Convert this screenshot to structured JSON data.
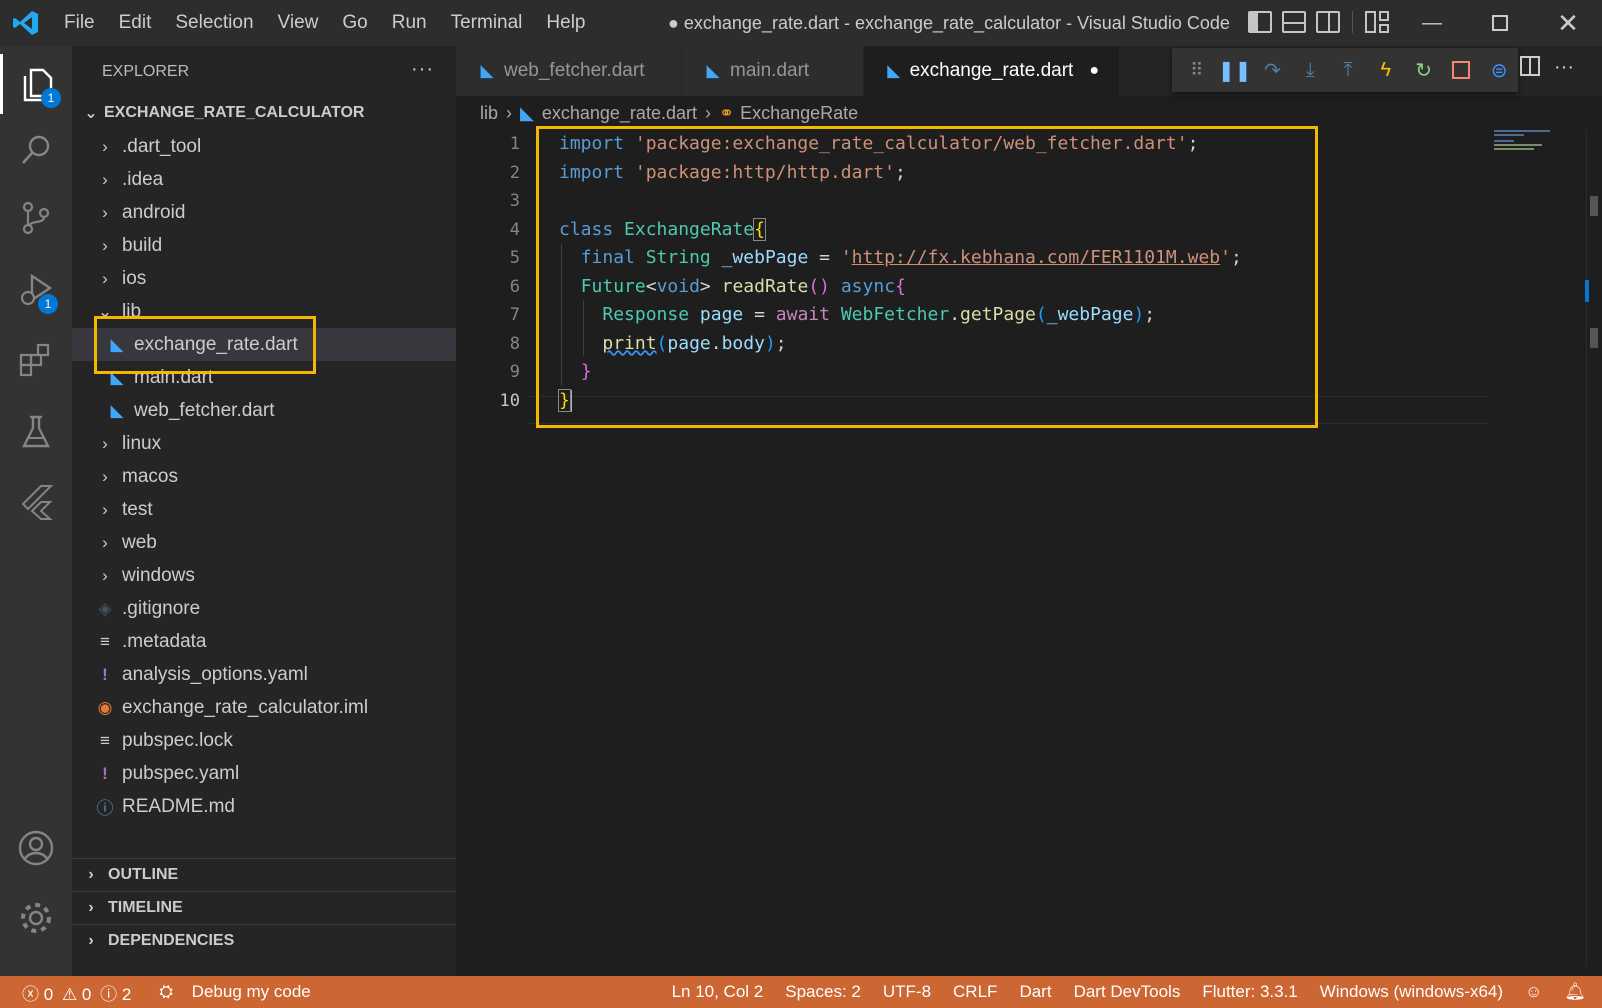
{
  "app": {
    "title": "● exchange_rate.dart - exchange_rate_calculator - Visual Studio Code"
  },
  "menu": [
    "File",
    "Edit",
    "Selection",
    "View",
    "Go",
    "Run",
    "Terminal",
    "Help"
  ],
  "activity": {
    "explorer_badge": "1",
    "debug_badge": "1"
  },
  "explorer": {
    "header": "EXPLORER",
    "more": "···",
    "project": "EXCHANGE_RATE_CALCULATOR",
    "items": [
      {
        "label": ".dart_tool",
        "type": "folder"
      },
      {
        "label": ".idea",
        "type": "folder"
      },
      {
        "label": "android",
        "type": "folder"
      },
      {
        "label": "build",
        "type": "folder"
      },
      {
        "label": "ios",
        "type": "folder"
      },
      {
        "label": "lib",
        "type": "folder-open"
      },
      {
        "label": "exchange_rate.dart",
        "type": "dart"
      },
      {
        "label": "main.dart",
        "type": "dart"
      },
      {
        "label": "web_fetcher.dart",
        "type": "dart"
      },
      {
        "label": "linux",
        "type": "folder"
      },
      {
        "label": "macos",
        "type": "folder"
      },
      {
        "label": "test",
        "type": "folder"
      },
      {
        "label": "web",
        "type": "folder"
      },
      {
        "label": "windows",
        "type": "folder"
      },
      {
        "label": ".gitignore",
        "type": "git"
      },
      {
        "label": ".metadata",
        "type": "lines"
      },
      {
        "label": "analysis_options.yaml",
        "type": "yaml"
      },
      {
        "label": "exchange_rate_calculator.iml",
        "type": "rss"
      },
      {
        "label": "pubspec.lock",
        "type": "lines"
      },
      {
        "label": "pubspec.yaml",
        "type": "yaml"
      },
      {
        "label": "README.md",
        "type": "info"
      }
    ],
    "sections": [
      "OUTLINE",
      "TIMELINE",
      "DEPENDENCIES"
    ]
  },
  "tabs": [
    {
      "label": "web_fetcher.dart"
    },
    {
      "label": "main.dart"
    },
    {
      "label": "exchange_rate.dart",
      "dirty": "●"
    }
  ],
  "breadcrumb": {
    "folder": "lib",
    "file": "exchange_rate.dart",
    "symbol": "ExchangeRate"
  },
  "editor": {
    "line_numbers": [
      "1",
      "2",
      "3",
      "4",
      "5",
      "6",
      "7",
      "8",
      "9",
      "10"
    ],
    "code": {
      "import_kw": "import",
      "import1": "'package:exchange_rate_calculator/web_fetcher.dart'",
      "import2": "'package:http/http.dart'",
      "semi": ";",
      "class_kw": "class",
      "class_name": "ExchangeRate",
      "open_brace": "{",
      "final_kw": "final",
      "string_type": "String",
      "webpage_var": "_webPage",
      "eq": " = ",
      "url_quote": "'",
      "url": "http://fx.kebhana.com/FER1101M.web",
      "future_type": "Future",
      "void_kw": "void",
      "read_rate": "readRate",
      "async_kw": "async",
      "response_type": "Response",
      "page_var": "page",
      "await_kw": "await",
      "fetcher": "WebFetcher",
      "get_page": "getPage",
      "print_fn": "print",
      "body": "body",
      "close_brace": "}"
    }
  },
  "status": {
    "errors": "0",
    "warnings": "0",
    "infos": "2",
    "debug": "Debug my code",
    "position": "Ln 10, Col 2",
    "spaces": "Spaces: 2",
    "encoding": "UTF-8",
    "eol": "CRLF",
    "language": "Dart",
    "devtools": "Dart DevTools",
    "flutter": "Flutter: 3.3.1",
    "device": "Windows (windows-x64)"
  },
  "colors": {
    "status_bar": "#cc6633",
    "highlight_box": "#f5b800",
    "accent": "#0078d4"
  }
}
